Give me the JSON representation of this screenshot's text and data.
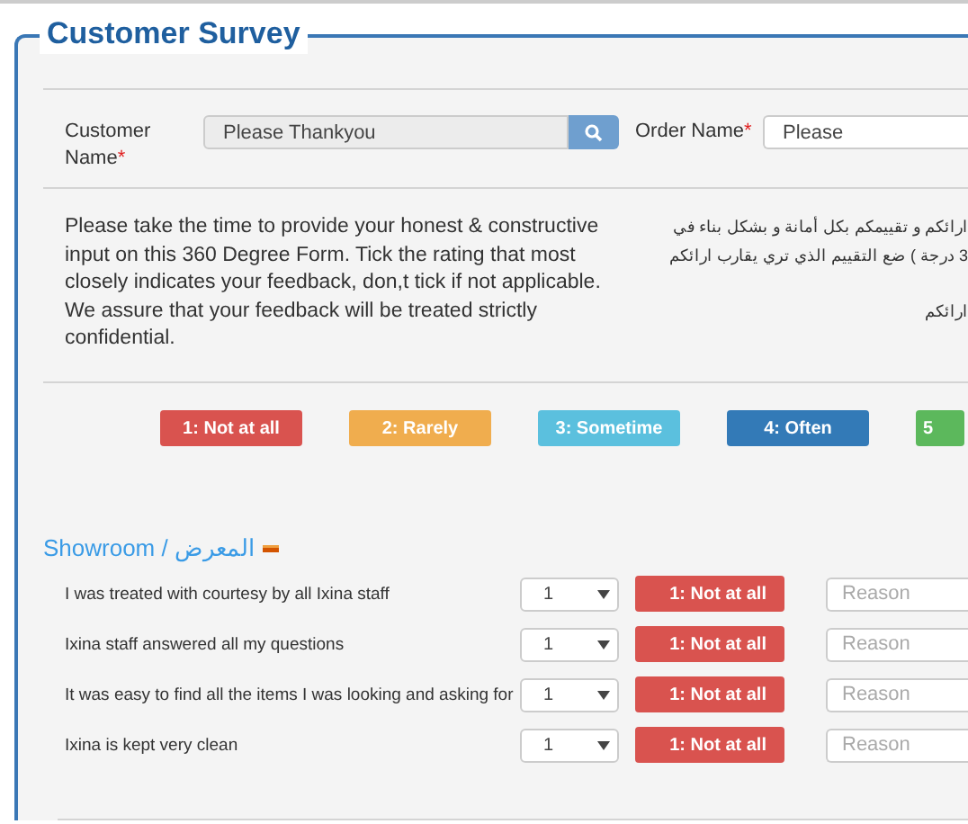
{
  "title": "Customer Survey",
  "customer_field": {
    "label": "Customer Name",
    "required_mark": "*",
    "value": "Please Thankyou"
  },
  "order_field": {
    "label": "Order Name",
    "required_mark": "*",
    "value": "Please"
  },
  "intro": "Please take the time to provide your honest & constructive input on this 360 Degree Form. Tick the rating that most closely indicates your feedback, don,t tick if not applicable. We assure that your feedback will be treated strictly confidential.",
  "intro_arabic": [
    "ارائكم و تقييمكم بكل أمانة و بشكل بناء في",
    "3 درجة ) ضع التقييم الذي تري يقارب ارائكم"
  ],
  "intro_arabic_last": "ارائكم",
  "scale": [
    {
      "label": "1: Not at all",
      "color": "#d9534f"
    },
    {
      "label": "2: Rarely",
      "color": "#f0ad4e"
    },
    {
      "label": "3: Sometime",
      "color": "#5bc0de"
    },
    {
      "label": "4: Often",
      "color": "#337ab7"
    },
    {
      "label": "5",
      "color": "#5cb85c"
    }
  ],
  "section": {
    "title": "Showroom / المعرض",
    "collapsed": false,
    "questions": [
      {
        "text": "I was treated with courtesy by all Ixina staff",
        "rating": "1",
        "rating_label": "1: Not at all",
        "color": "#d9534f",
        "reason_placeholder": "Reason"
      },
      {
        "text": "Ixina staff answered all my questions",
        "rating": "1",
        "rating_label": "1: Not at all",
        "color": "#d9534f",
        "reason_placeholder": "Reason"
      },
      {
        "text": "It was easy to find all the items I was looking and asking for",
        "rating": "1",
        "rating_label": "1: Not at all",
        "color": "#d9534f",
        "reason_placeholder": "Reason"
      },
      {
        "text": "Ixina is kept very clean",
        "rating": "1",
        "rating_label": "1: Not at all",
        "color": "#d9534f",
        "reason_placeholder": "Reason"
      }
    ]
  }
}
